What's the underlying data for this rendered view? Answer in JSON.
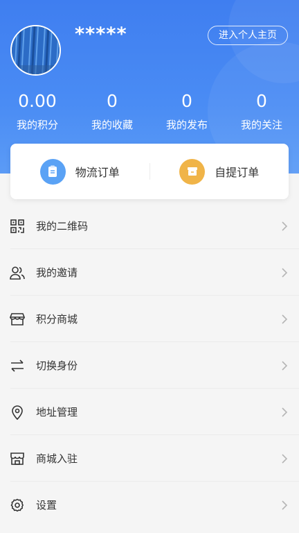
{
  "user": {
    "name": "*****",
    "profile_button": "进入个人主页"
  },
  "stats": [
    {
      "value": "0.00",
      "label": "我的积分"
    },
    {
      "value": "0",
      "label": "我的收藏"
    },
    {
      "value": "0",
      "label": "我的发布"
    },
    {
      "value": "0",
      "label": "我的关注"
    }
  ],
  "orders": [
    {
      "label": "物流订单",
      "icon": "clipboard-icon",
      "color": "#5aa2f5"
    },
    {
      "label": "自提订单",
      "icon": "box-icon",
      "color": "#f0b448"
    }
  ],
  "menu": [
    {
      "label": "我的二维码",
      "icon": "qr-code-icon"
    },
    {
      "label": "我的邀请",
      "icon": "users-icon"
    },
    {
      "label": "积分商城",
      "icon": "store-icon"
    },
    {
      "label": "切换身份",
      "icon": "swap-icon"
    },
    {
      "label": "地址管理",
      "icon": "location-pin-icon"
    },
    {
      "label": "商城入驻",
      "icon": "shop-icon"
    },
    {
      "label": "设置",
      "icon": "gear-icon"
    }
  ],
  "colors": {
    "header_blue": "#3f7ef0",
    "text_primary": "#333333",
    "chevron": "#b5b5b5"
  }
}
